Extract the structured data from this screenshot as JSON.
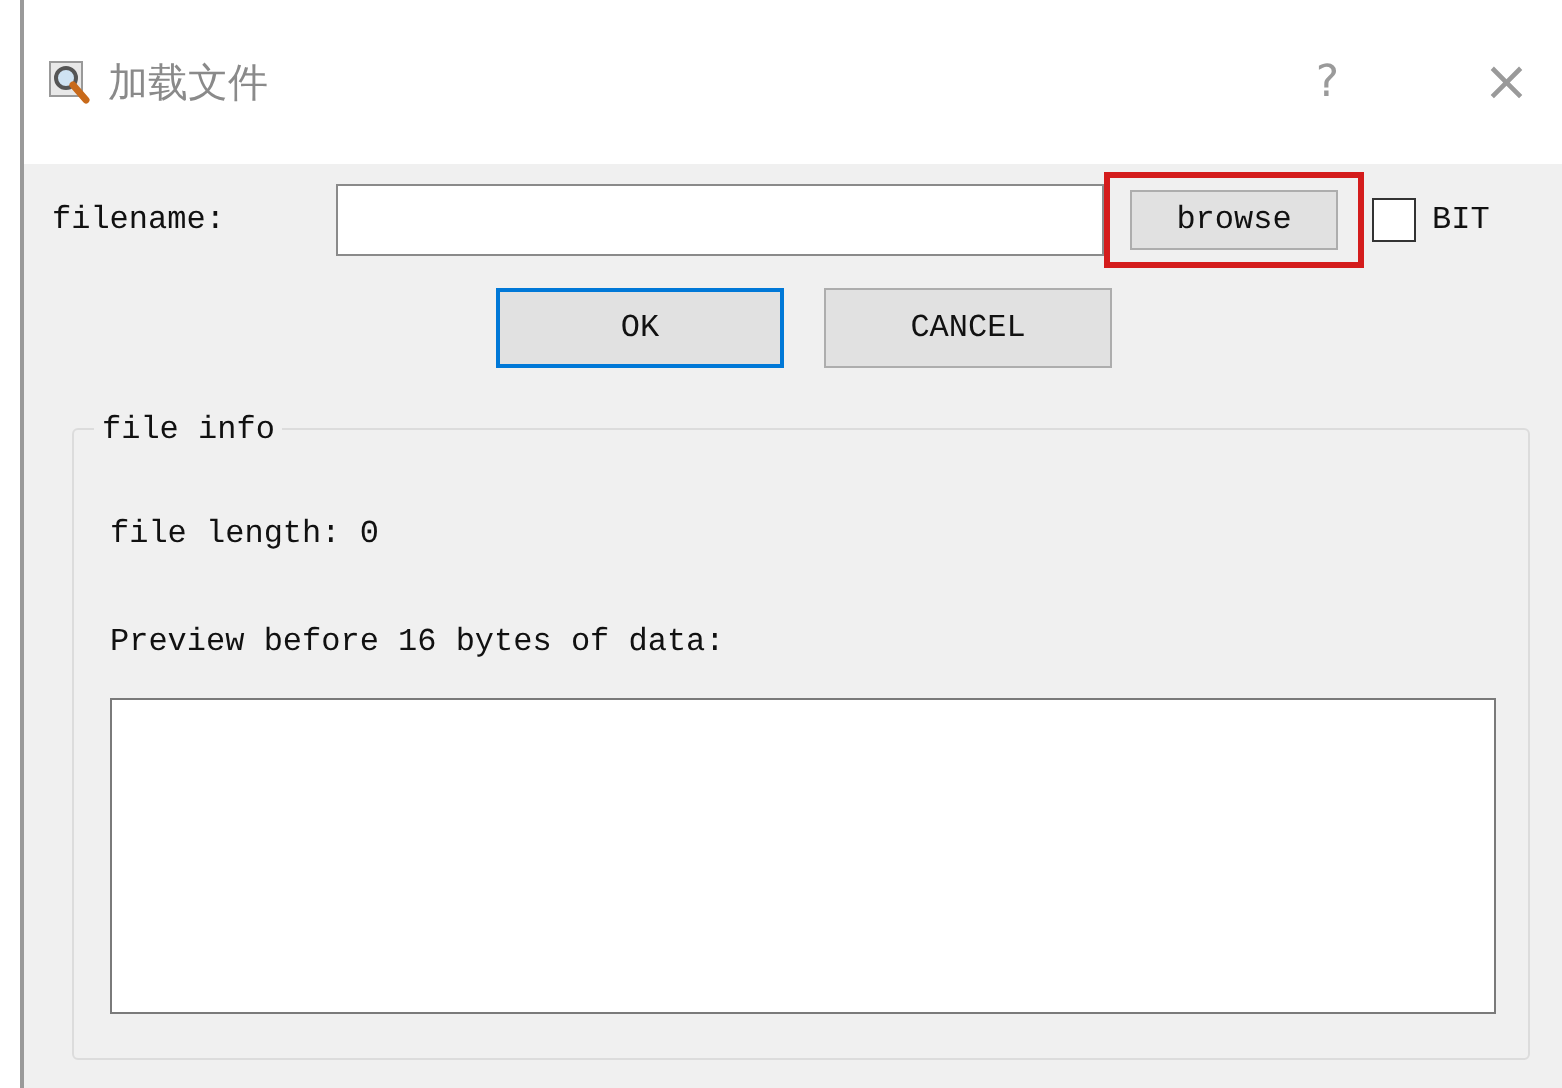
{
  "window": {
    "title": "加载文件",
    "help": "?",
    "close": "×"
  },
  "filename": {
    "label": "filename:"
  },
  "browse": {
    "label": "browse",
    "highlighted": true
  },
  "bit": {
    "label": "BIT",
    "checked": false
  },
  "buttons": [
    {
      "label": "OK",
      "focused": true
    },
    {
      "label": "CANCEL",
      "focused": false
    }
  ],
  "file_info": {
    "title": "file info",
    "length_text": "file length: 0",
    "preview_label": "Preview before 16 bytes of data:"
  }
}
